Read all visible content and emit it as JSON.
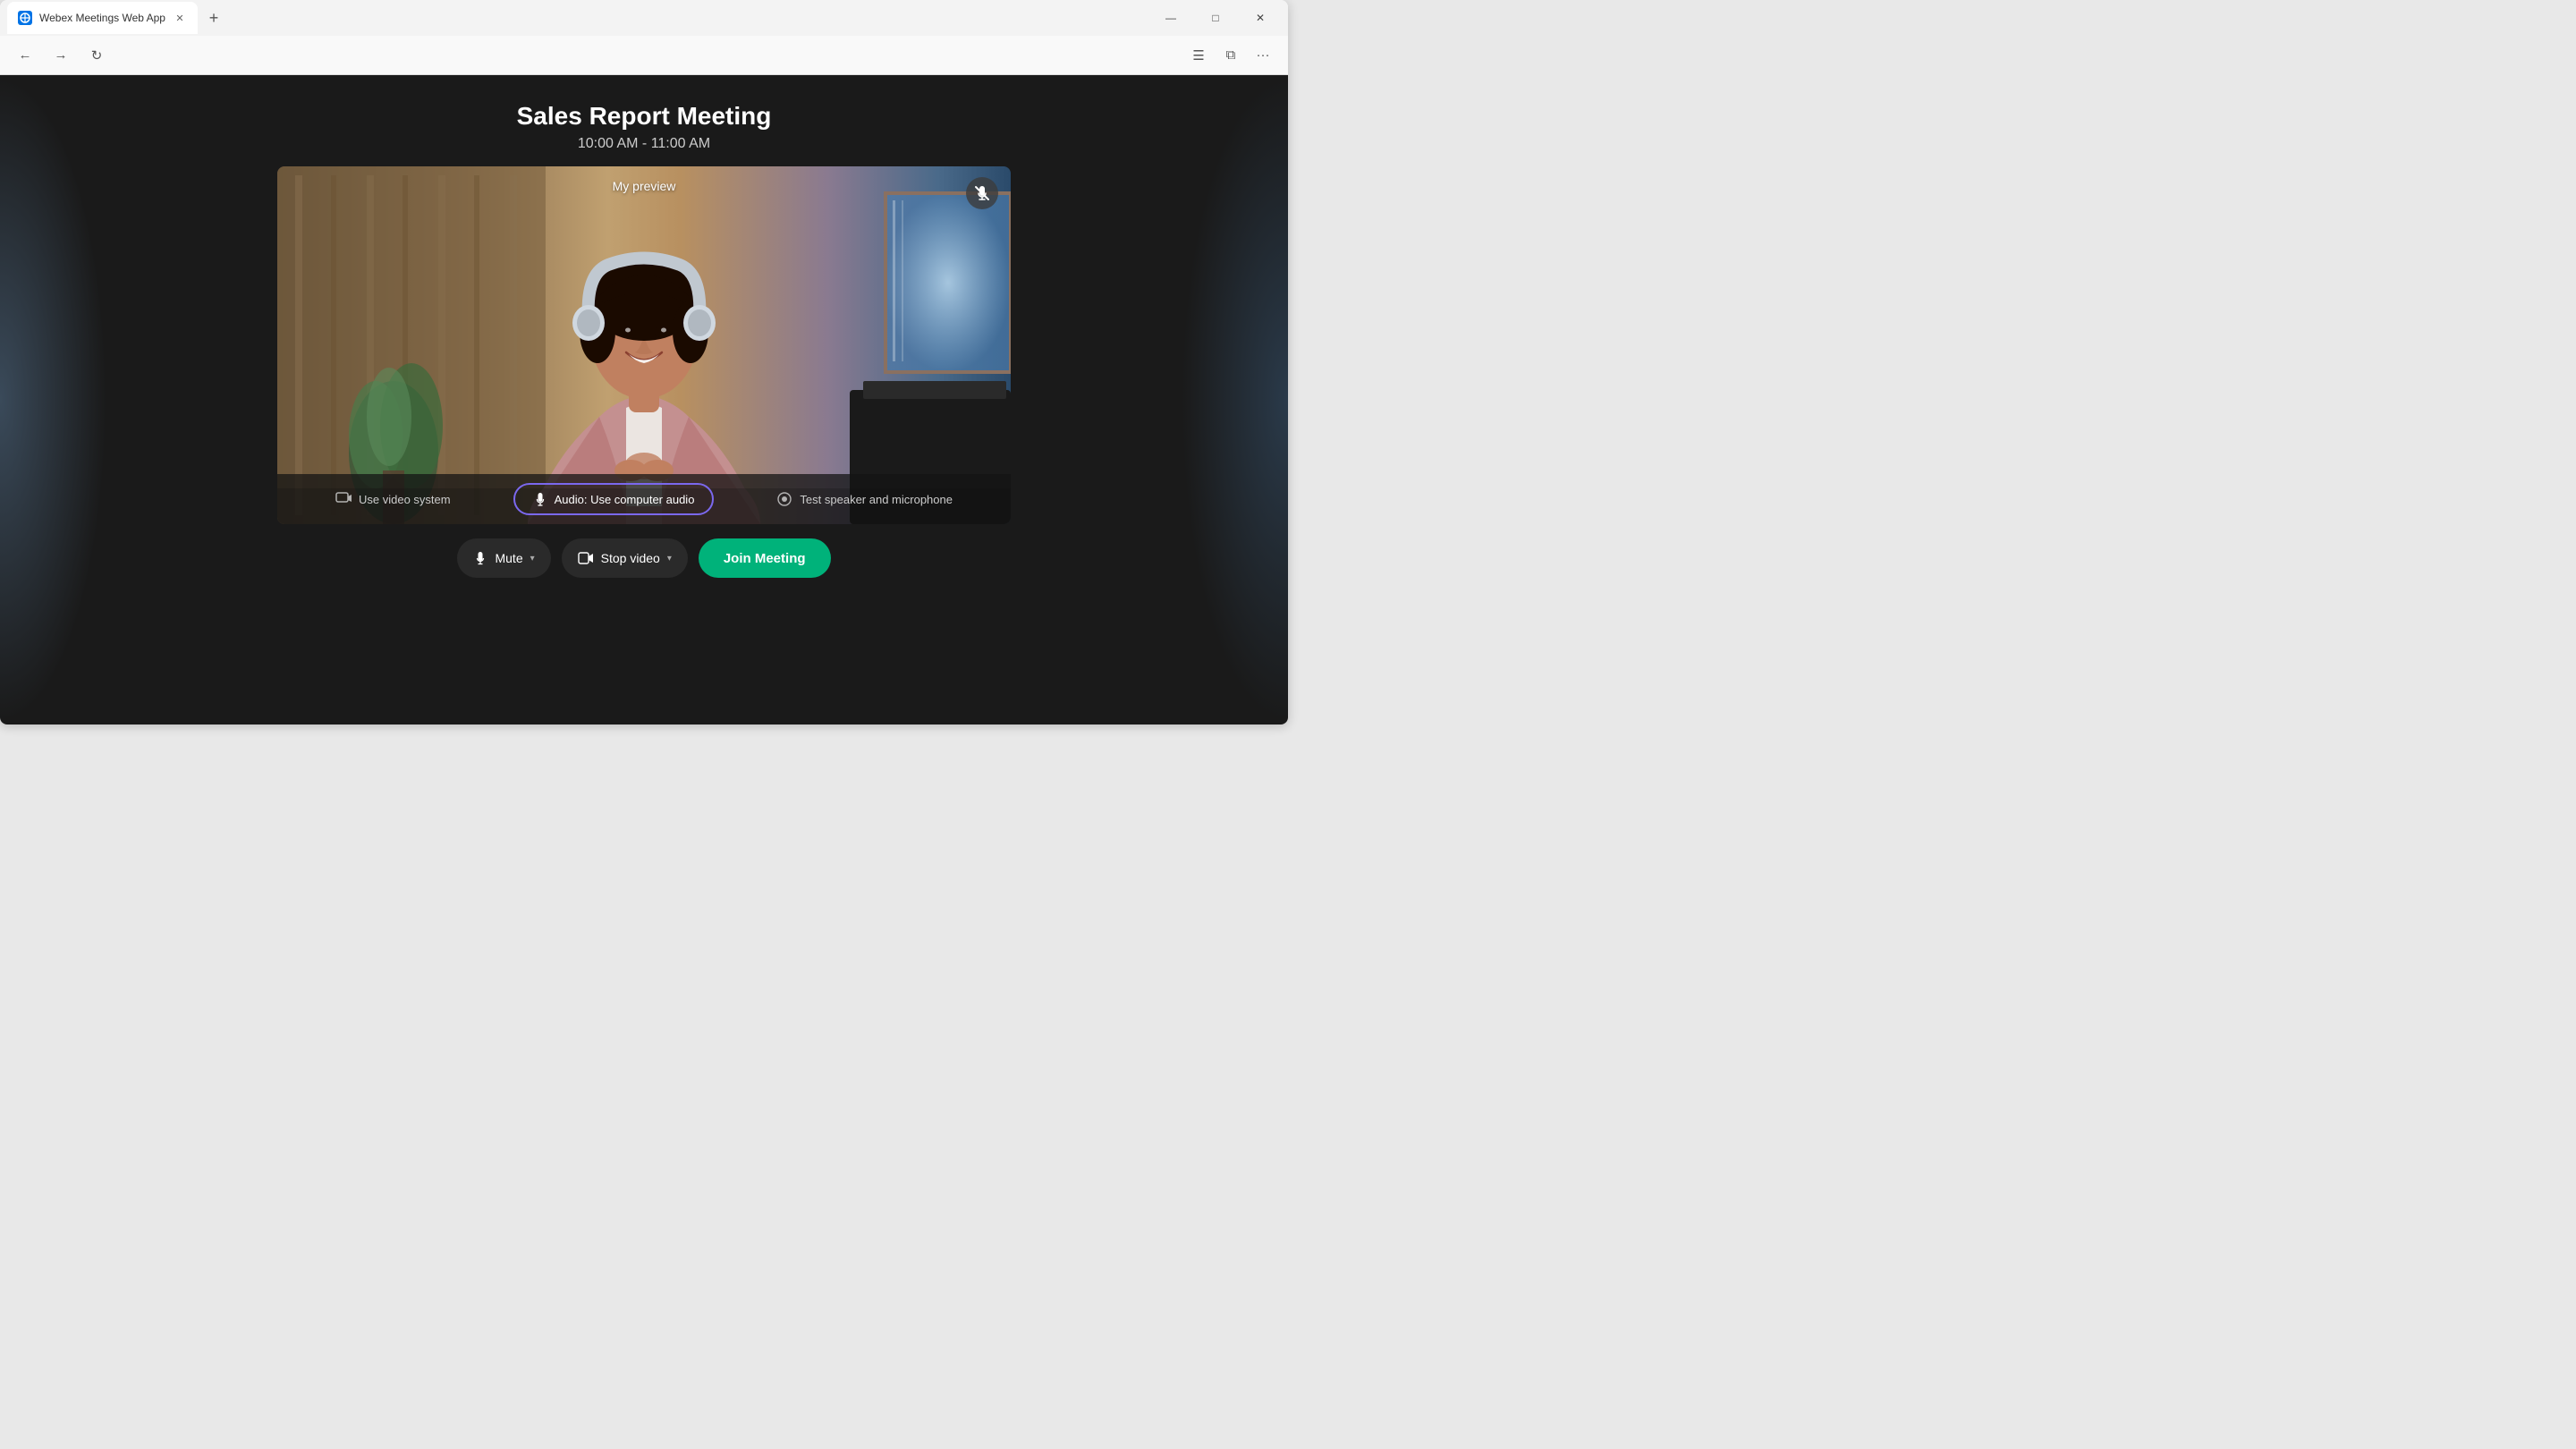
{
  "browser": {
    "tab_title": "Webex Meetings Web App",
    "tab_favicon": "W",
    "new_tab_label": "+",
    "window_controls": {
      "minimize": "—",
      "maximize": "□",
      "close": "✕"
    }
  },
  "toolbar": {
    "back": "←",
    "forward": "→",
    "reload": "↻",
    "menu_icon": "☰",
    "sidebar_icon": "⧉",
    "more_icon": "···"
  },
  "meeting": {
    "title": "Sales Report Meeting",
    "time": "10:00 AM - 11:00 AM",
    "preview_label": "My preview"
  },
  "controls": {
    "video_system_label": "Use video system",
    "audio_label": "Audio: Use computer audio",
    "test_label": "Test speaker and microphone",
    "mute_label": "Mute",
    "stop_video_label": "Stop video",
    "join_label": "Join Meeting"
  },
  "colors": {
    "join_btn": "#00B27A",
    "audio_btn_border": "#7B68EE",
    "bg": "#1a1a1a"
  }
}
